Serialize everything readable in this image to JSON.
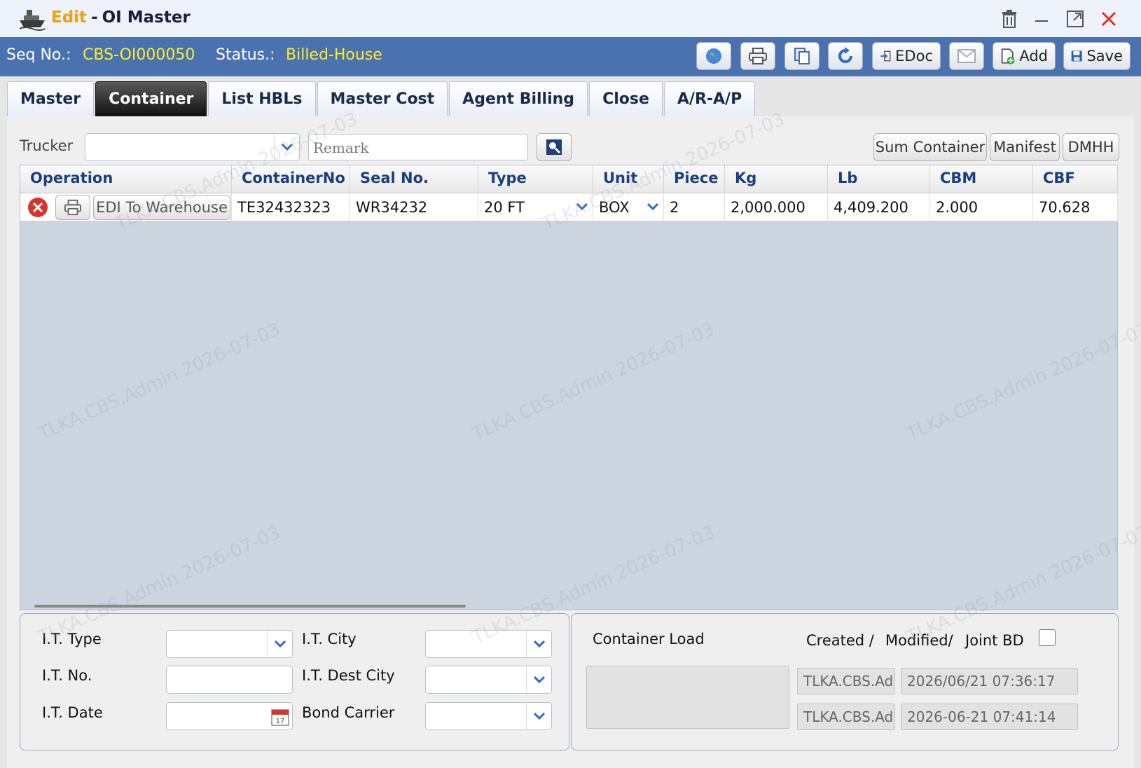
{
  "window": {
    "title_mode": "Edit",
    "title_sep": "-",
    "title_name": "OI Master"
  },
  "header": {
    "seq_label": "Seq No.:",
    "seq_value": "CBS-OI000050",
    "status_label": "Status.:",
    "status_value": "Billed-House",
    "buttons": {
      "edoc": "EDoc",
      "add": "Add",
      "save": "Save"
    }
  },
  "tabs": [
    "Master",
    "Container",
    "List HBLs",
    "Master Cost",
    "Agent Billing",
    "Close",
    "A/R-A/P"
  ],
  "active_tab": "Container",
  "filter": {
    "trucker_label": "Trucker",
    "trucker_value": "",
    "remark_placeholder": "Remark",
    "sum_container": "Sum Container",
    "manifest": "Manifest",
    "dmhh": "DMHH"
  },
  "grid": {
    "columns": [
      "Operation",
      "ContainerNo",
      "Seal No.",
      "Type",
      "Unit",
      "Piece",
      "Kg",
      "Lb",
      "CBM",
      "CBF"
    ],
    "rows": [
      {
        "edi_button": "EDI To Warehouse",
        "container_no": "TE32432323",
        "seal_no": "WR34232",
        "type": "20 FT",
        "unit": "BOX",
        "piece": "2",
        "kg": "2,000.000",
        "lb": "4,409.200",
        "cbm": "2.000",
        "cbf": "70.628"
      }
    ]
  },
  "it_form": {
    "it_type": "I.T. Type",
    "it_city": "I.T. City",
    "it_no": "I.T. No.",
    "it_dest_city": "I.T. Dest City",
    "it_date": "I.T. Date",
    "bond_carrier": "Bond Carrier"
  },
  "info": {
    "container_load": "Container Load",
    "created_label": "Created /",
    "modified_label": "Modified/",
    "joint_bd": "Joint BD",
    "created_by": "TLKA.CBS.Ad",
    "created_at": "2026/06/21 07:36:17",
    "modified_by": "TLKA.CBS.Ad",
    "modified_at": "2026-06-21 07:41:14"
  },
  "watermark": "TLKA.CBS.Admin 2026-07-03",
  "colors": {
    "header_blue": "#4a71b0",
    "accent_yellow": "#ffee22",
    "edit_orange": "#f0a010"
  }
}
